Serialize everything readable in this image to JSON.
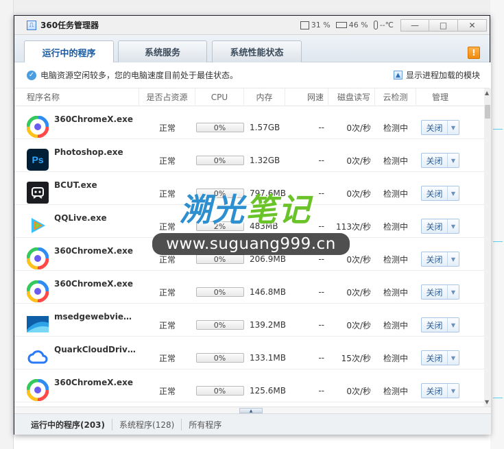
{
  "window": {
    "title": "360任务管理器",
    "cpu_usage": "31 %",
    "mem_usage": "46 %",
    "temperature": "--℃",
    "minimize": "—",
    "maximize": "□",
    "close": "✕"
  },
  "tabs": [
    {
      "label": "运行中的程序"
    },
    {
      "label": "系统服务"
    },
    {
      "label": "系统性能状态"
    }
  ],
  "warning_badge": "!",
  "info": {
    "status_text": "电脑资源空闲较多，您的电脑速度目前处于最佳状态。",
    "module_link": "显示进程加载的模块"
  },
  "columns": {
    "name": "程序名称",
    "resource": "是否占资源",
    "cpu": "CPU",
    "memory": "内存",
    "network": "网速",
    "disk": "磁盘读写",
    "cloud": "云检测",
    "manage": "管理"
  },
  "processes": [
    {
      "name": "360ChromeX.exe",
      "resource": "正常",
      "cpu": "0%",
      "cpu_fraction": 0.0,
      "memory": "1.57GB",
      "network": "--",
      "disk": "0次/秒",
      "cloud": "检测中",
      "action": "关闭",
      "icon": "chrome360-icon"
    },
    {
      "name": "Photoshop.exe",
      "resource": "正常",
      "cpu": "0%",
      "cpu_fraction": 0.0,
      "memory": "1.32GB",
      "network": "--",
      "disk": "0次/秒",
      "cloud": "检测中",
      "action": "关闭",
      "icon": "photoshop-icon"
    },
    {
      "name": "BCUT.exe",
      "resource": "正常",
      "cpu": "0%",
      "cpu_fraction": 0.0,
      "memory": "797.6MB",
      "network": "--",
      "disk": "0次/秒",
      "cloud": "检测中",
      "action": "关闭",
      "icon": "bcut-icon"
    },
    {
      "name": "QQLive.exe",
      "resource": "正常",
      "cpu": "2%",
      "cpu_fraction": 0.02,
      "memory": "483MB",
      "network": "--",
      "disk": "113次/秒",
      "cloud": "检测中",
      "action": "关闭",
      "icon": "qqlive-icon"
    },
    {
      "name": "360ChromeX.exe",
      "resource": "正常",
      "cpu": "0%",
      "cpu_fraction": 0.0,
      "memory": "206.9MB",
      "network": "--",
      "disk": "0次/秒",
      "cloud": "检测中",
      "action": "关闭",
      "icon": "chrome360-icon"
    },
    {
      "name": "360ChromeX.exe",
      "resource": "正常",
      "cpu": "0%",
      "cpu_fraction": 0.0,
      "memory": "146.8MB",
      "network": "--",
      "disk": "0次/秒",
      "cloud": "检测中",
      "action": "关闭",
      "icon": "chrome360-icon"
    },
    {
      "name": "msedgewebview2....",
      "resource": "正常",
      "cpu": "0%",
      "cpu_fraction": 0.0,
      "memory": "139.2MB",
      "network": "--",
      "disk": "0次/秒",
      "cloud": "检测中",
      "action": "关闭",
      "icon": "msedgewebview-icon"
    },
    {
      "name": "QuarkCloudDrive.e...",
      "resource": "正常",
      "cpu": "0%",
      "cpu_fraction": 0.0,
      "memory": "133.1MB",
      "network": "--",
      "disk": "15次/秒",
      "cloud": "检测中",
      "action": "关闭",
      "icon": "quarkcloud-icon"
    },
    {
      "name": "360ChromeX.exe",
      "resource": "正常",
      "cpu": "0%",
      "cpu_fraction": 0.0,
      "memory": "125.6MB",
      "network": "--",
      "disk": "0次/秒",
      "cloud": "检测中",
      "action": "关闭",
      "icon": "chrome360-icon"
    }
  ],
  "footer": {
    "running": "运行中的程序(203)",
    "system": "系统程序(128)",
    "all": "所有程序"
  },
  "watermark": {
    "title_part1": "溯光",
    "title_part2": "笔记",
    "url": "www.suguang999.cn"
  }
}
